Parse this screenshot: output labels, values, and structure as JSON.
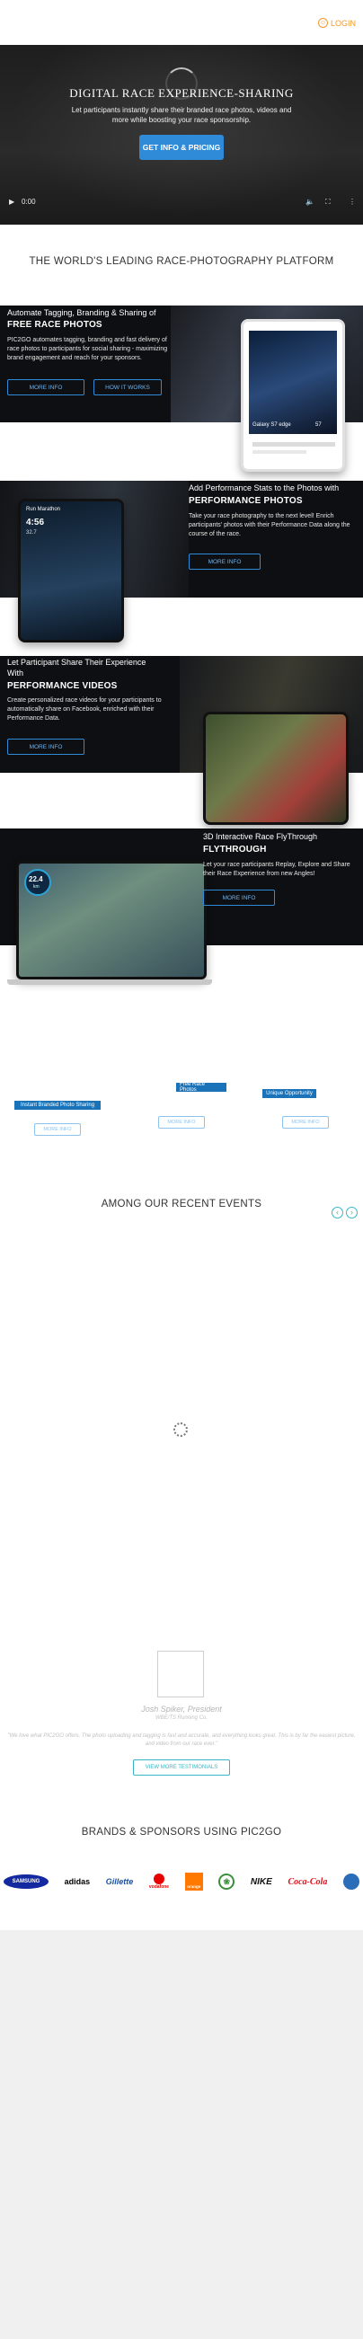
{
  "header": {
    "login_label": "LOGIN",
    "login_icon": "user-icon"
  },
  "hero": {
    "title": "DIGITAL RACE EXPERIENCE-SHARING",
    "subtitle": "Let participants instantly share their branded race photos, videos and more while boosting your race sponsorship.",
    "cta_label": "GET INFO & PRICING",
    "time": "0:00"
  },
  "platform_title": "THE WORLD'S LEADING RACE-PHOTOGRAPHY PLATFORM",
  "features": [
    {
      "lead": "Automate Tagging, Branding & Sharing of",
      "title": "FREE RACE PHOTOS",
      "body": "PIC2GO automates tagging, branding and fast delivery of race photos to participants for social sharing - maximizing brand engagement and reach for your sponsors.",
      "btn1": "MORE INFO",
      "btn2": "HOW IT WORKS",
      "phone_caption": "Galaxy S7 edge",
      "phone_value": "57"
    },
    {
      "lead": "Add Performance Stats to the Photos with",
      "title": "PERFORMANCE PHOTOS",
      "body": "Take your race photography to the next level! Enrich participants' photos with their Performance Data along the course of the race.",
      "btn1": "MORE INFO",
      "tablet_label": "Run Marathon",
      "tablet_value": "4:56",
      "tablet_km": "32.7"
    },
    {
      "lead": "Let Participant Share Their Experience With",
      "title": "PERFORMANCE VIDEOS",
      "body": "Create personalized race videos for your participants to automatically share on Facebook, enriched with their Performance Data.",
      "btn1": "MORE INFO"
    },
    {
      "lead": "3D Interactive Race FlyThrough",
      "title": "FLYTHROUGH",
      "body": "Let your race participants Replay, Explore and Share their Race Experience from new Angles!",
      "btn1": "MORE INFO",
      "gauge_value": "22.4",
      "gauge_unit": "km"
    }
  ],
  "offers": [
    {
      "tag": "Instant Branded Photo Sharing",
      "btn": "MORE INFO"
    },
    {
      "tag": "Free Race Photos",
      "btn": "MORE INFO"
    },
    {
      "tag": "Unique Opportunity",
      "btn": "MORE INFO"
    }
  ],
  "events": {
    "title": "AMONG OUR RECENT EVENTS",
    "prev": "‹",
    "next": "›"
  },
  "testimonial": {
    "name": "Josh Spiker, President",
    "role": "WBE/TS Running Co.",
    "quote": "\"We love what PIC2GO offers. The photo uploading and tagging is fast and accurate, and everything looks great. This is by far the easiest picture, and video from our race ever.\"",
    "btn": "VIEW MORE TESTIMONIALS"
  },
  "brands": {
    "title": "BRANDS & SPONSORS USING PIC2GO",
    "items": [
      {
        "name": "SAMSUNG",
        "color": "#1428a0"
      },
      {
        "name": "adidas",
        "color": "#000000"
      },
      {
        "name": "Gillette",
        "color": "#1a4fa3"
      },
      {
        "name": "vodafone",
        "color": "#e60000"
      },
      {
        "name": "orange",
        "color": "#ff7900"
      },
      {
        "name": "",
        "color": "#3a8f3a"
      },
      {
        "name": "NIKE",
        "color": "#111111"
      },
      {
        "name": "Coca-Cola",
        "color": "#d7141c"
      },
      {
        "name": "",
        "color": "#2a6db8"
      }
    ]
  }
}
